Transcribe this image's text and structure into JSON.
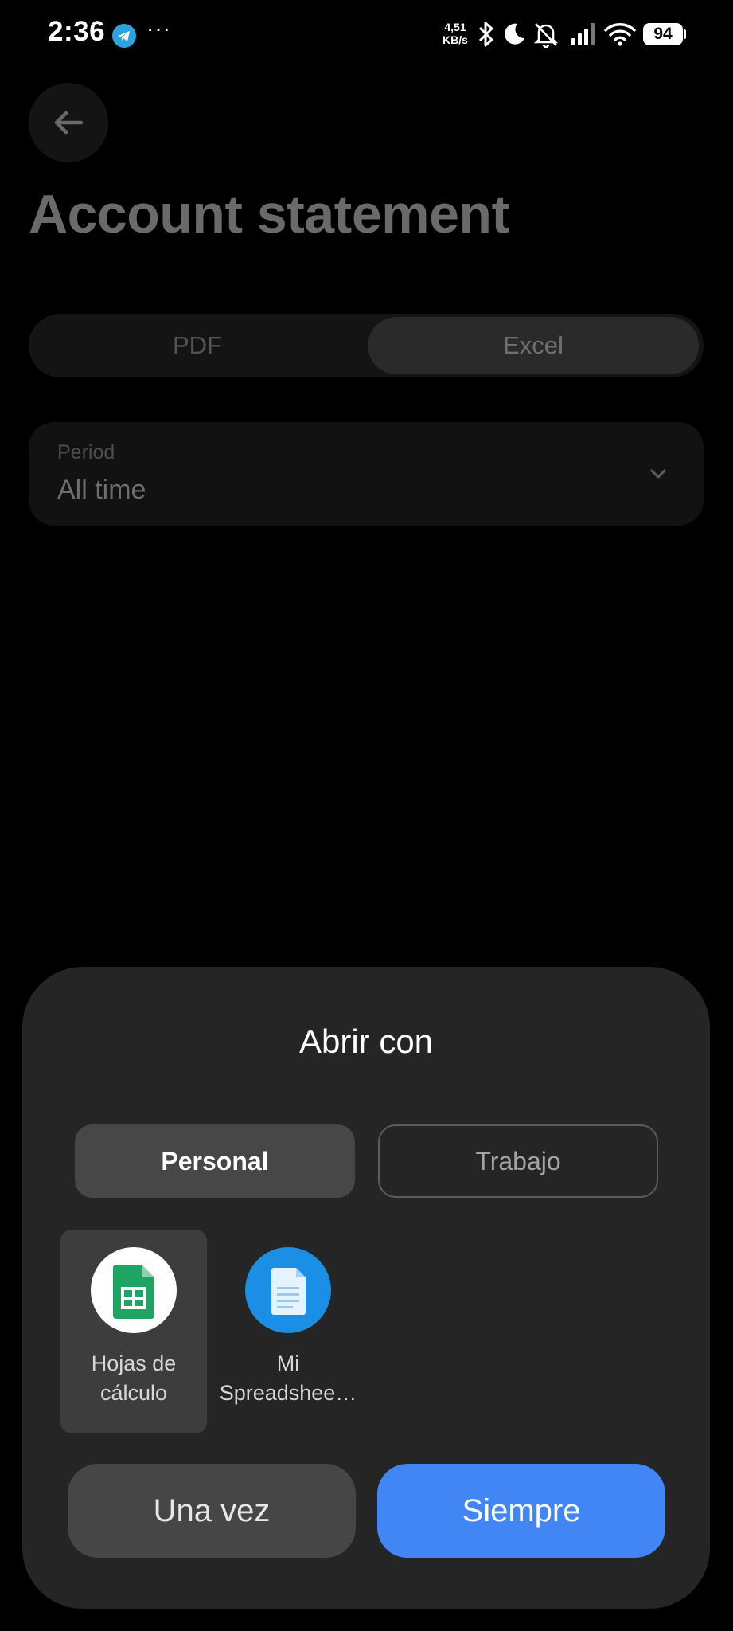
{
  "status_bar": {
    "time": "2:36",
    "overflow_indicator": "···",
    "net_speed_value": "4,51",
    "net_speed_unit": "KB/s",
    "battery": "94",
    "icons": [
      "telegram-icon",
      "bluetooth-icon",
      "moon-icon",
      "bell-off-icon",
      "signal-icon",
      "wifi-icon",
      "battery-icon"
    ]
  },
  "page": {
    "title": "Account statement",
    "format_options": [
      "PDF",
      "Excel"
    ],
    "selected_format": "Excel",
    "period": {
      "label": "Period",
      "value": "All time"
    }
  },
  "sheet": {
    "title": "Abrir con",
    "profile_tabs": [
      "Personal",
      "Trabajo"
    ],
    "selected_profile": "Personal",
    "apps": [
      {
        "label_line1": "Hojas de",
        "label_line2": "cálculo",
        "icon": "google-sheets-icon",
        "selected": true
      },
      {
        "label_line1": "Mi",
        "label_line2": "Spreadshee…",
        "icon": "mi-spreadsheet-icon",
        "selected": false
      }
    ],
    "buttons": {
      "once": "Una vez",
      "always": "Siempre"
    }
  },
  "colors": {
    "background": "#000000",
    "sheet": "#252525",
    "accent": "#4285f4",
    "selected_tile": "#3d3d3d"
  }
}
